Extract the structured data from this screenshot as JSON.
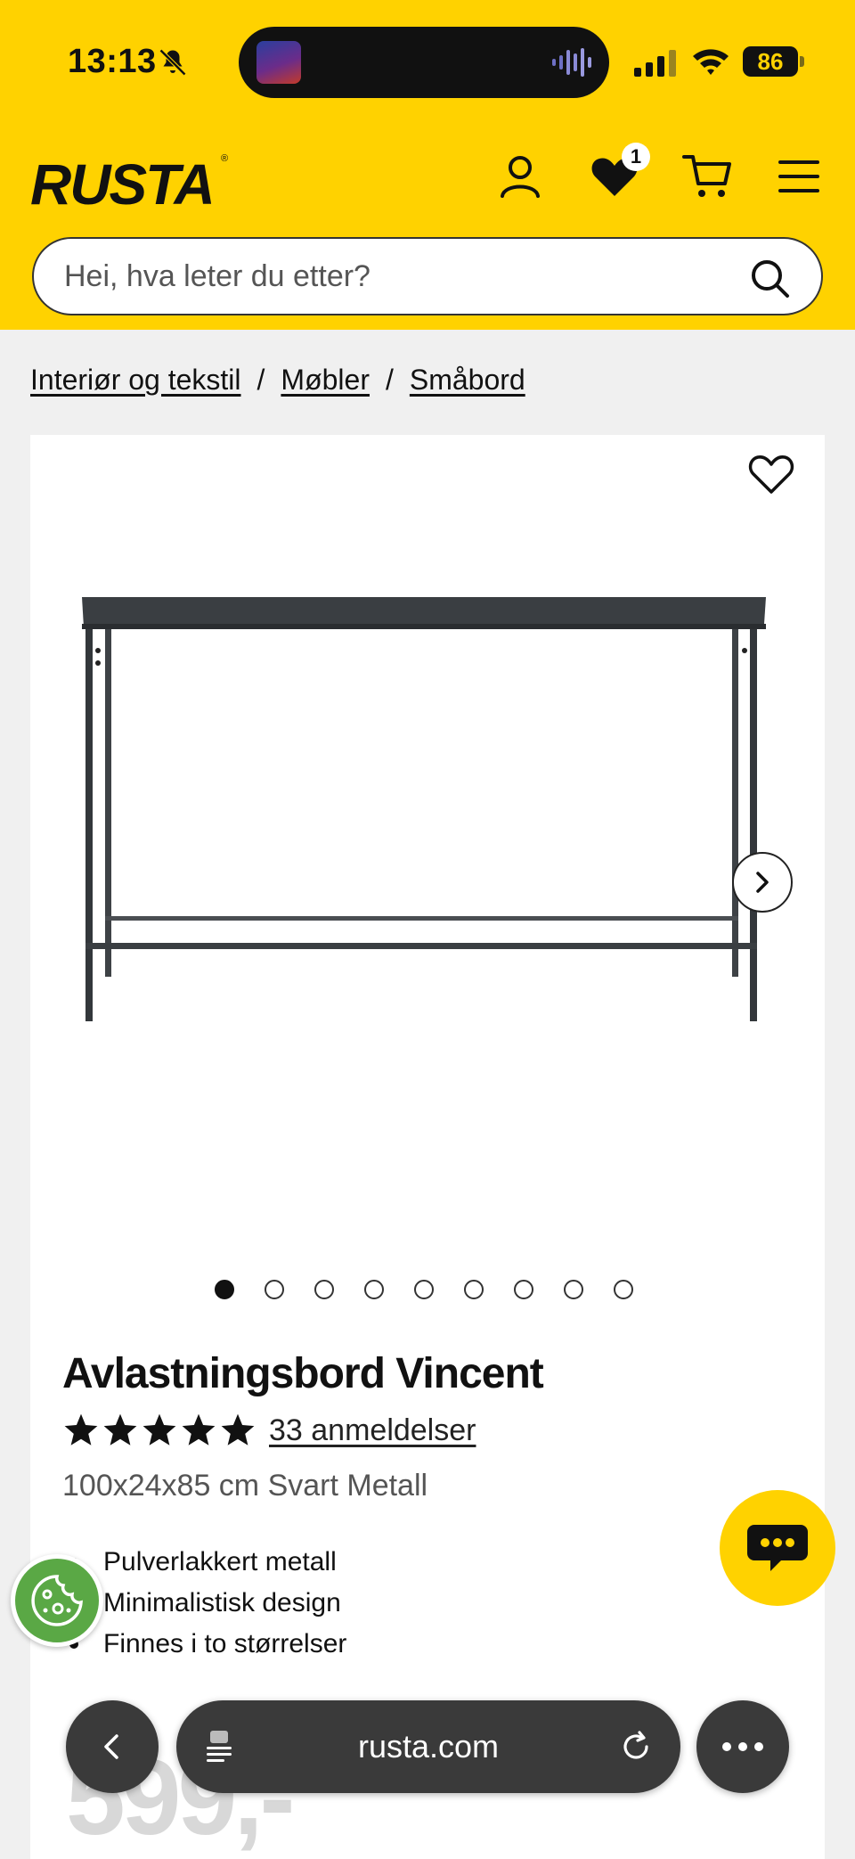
{
  "status_bar": {
    "time": "13:13",
    "battery": "86"
  },
  "header": {
    "logo_text": "RUSTA",
    "logo_mark": "®",
    "wishlist_count": "1",
    "icons": [
      "user-icon",
      "heart-icon",
      "cart-icon",
      "menu-icon"
    ],
    "accent_color": "#ffd200"
  },
  "search": {
    "placeholder": "Hei, hva leter du etter?"
  },
  "breadcrumb": {
    "items": [
      "Interiør og tekstil",
      "Møbler",
      "Småbord"
    ],
    "separator": "/"
  },
  "product": {
    "title": "Avlastningsbord Vincent",
    "rating": 5,
    "reviews_label": "33 anmeldelser",
    "specs": "100x24x85 cm Svart Metall",
    "features": [
      "Pulverlakkert metall",
      "Minimalistisk design",
      "Finnes i to størrelser"
    ],
    "image_count": 9,
    "active_image": 1,
    "price_partial": "599,-"
  },
  "browser": {
    "url": "rusta.com"
  }
}
